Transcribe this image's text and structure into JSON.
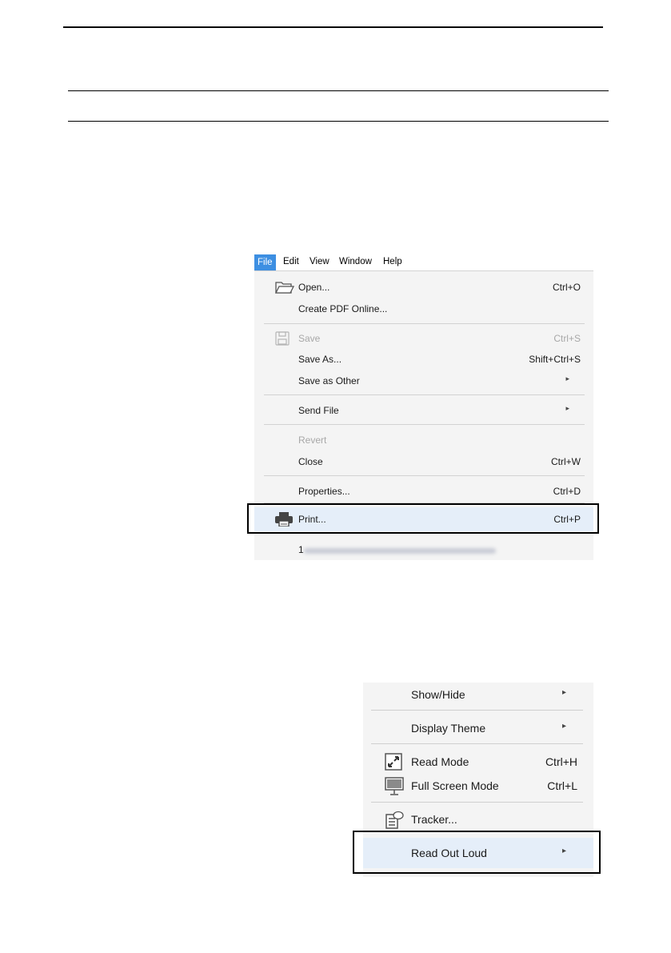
{
  "file_menu": {
    "menubar": [
      "File",
      "Edit",
      "View",
      "Window",
      "Help"
    ],
    "items": [
      {
        "label": "Open...",
        "shortcut": "Ctrl+O",
        "icon": "folder-open-icon"
      },
      {
        "label": "Create PDF Online...",
        "shortcut": ""
      },
      {
        "label": "Save",
        "shortcut": "Ctrl+S",
        "icon": "save-icon",
        "disabled": true
      },
      {
        "label": "Save As...",
        "shortcut": "Shift+Ctrl+S"
      },
      {
        "label": "Save as Other",
        "shortcut": "",
        "submenu": "▸"
      },
      {
        "label": "Send File",
        "shortcut": "",
        "submenu": "▸"
      },
      {
        "label": "Revert",
        "shortcut": "",
        "disabled": true
      },
      {
        "label": "Close",
        "shortcut": "Ctrl+W"
      },
      {
        "label": "Properties...",
        "shortcut": "Ctrl+D"
      },
      {
        "label": "Print...",
        "shortcut": "Ctrl+P",
        "icon": "printer-icon",
        "highlighted": true
      },
      {
        "label": "1",
        "shortcut": ""
      }
    ]
  },
  "view_menu": {
    "items": [
      {
        "label": "Show/Hide",
        "submenu": "▸"
      },
      {
        "label": "Display Theme",
        "submenu": "▸"
      },
      {
        "label": "Read Mode",
        "shortcut": "Ctrl+H",
        "icon": "read-mode-icon"
      },
      {
        "label": "Full Screen Mode",
        "shortcut": "Ctrl+L",
        "icon": "full-screen-icon"
      },
      {
        "label": "Tracker...",
        "icon": "tracker-icon"
      },
      {
        "label": "Read Out Loud",
        "submenu": "▸",
        "highlighted": true
      }
    ]
  },
  "colors": {
    "menu_active": "#3d8fe2",
    "highlight": "#e5eef9",
    "disabled_text": "#a8a8a8"
  }
}
